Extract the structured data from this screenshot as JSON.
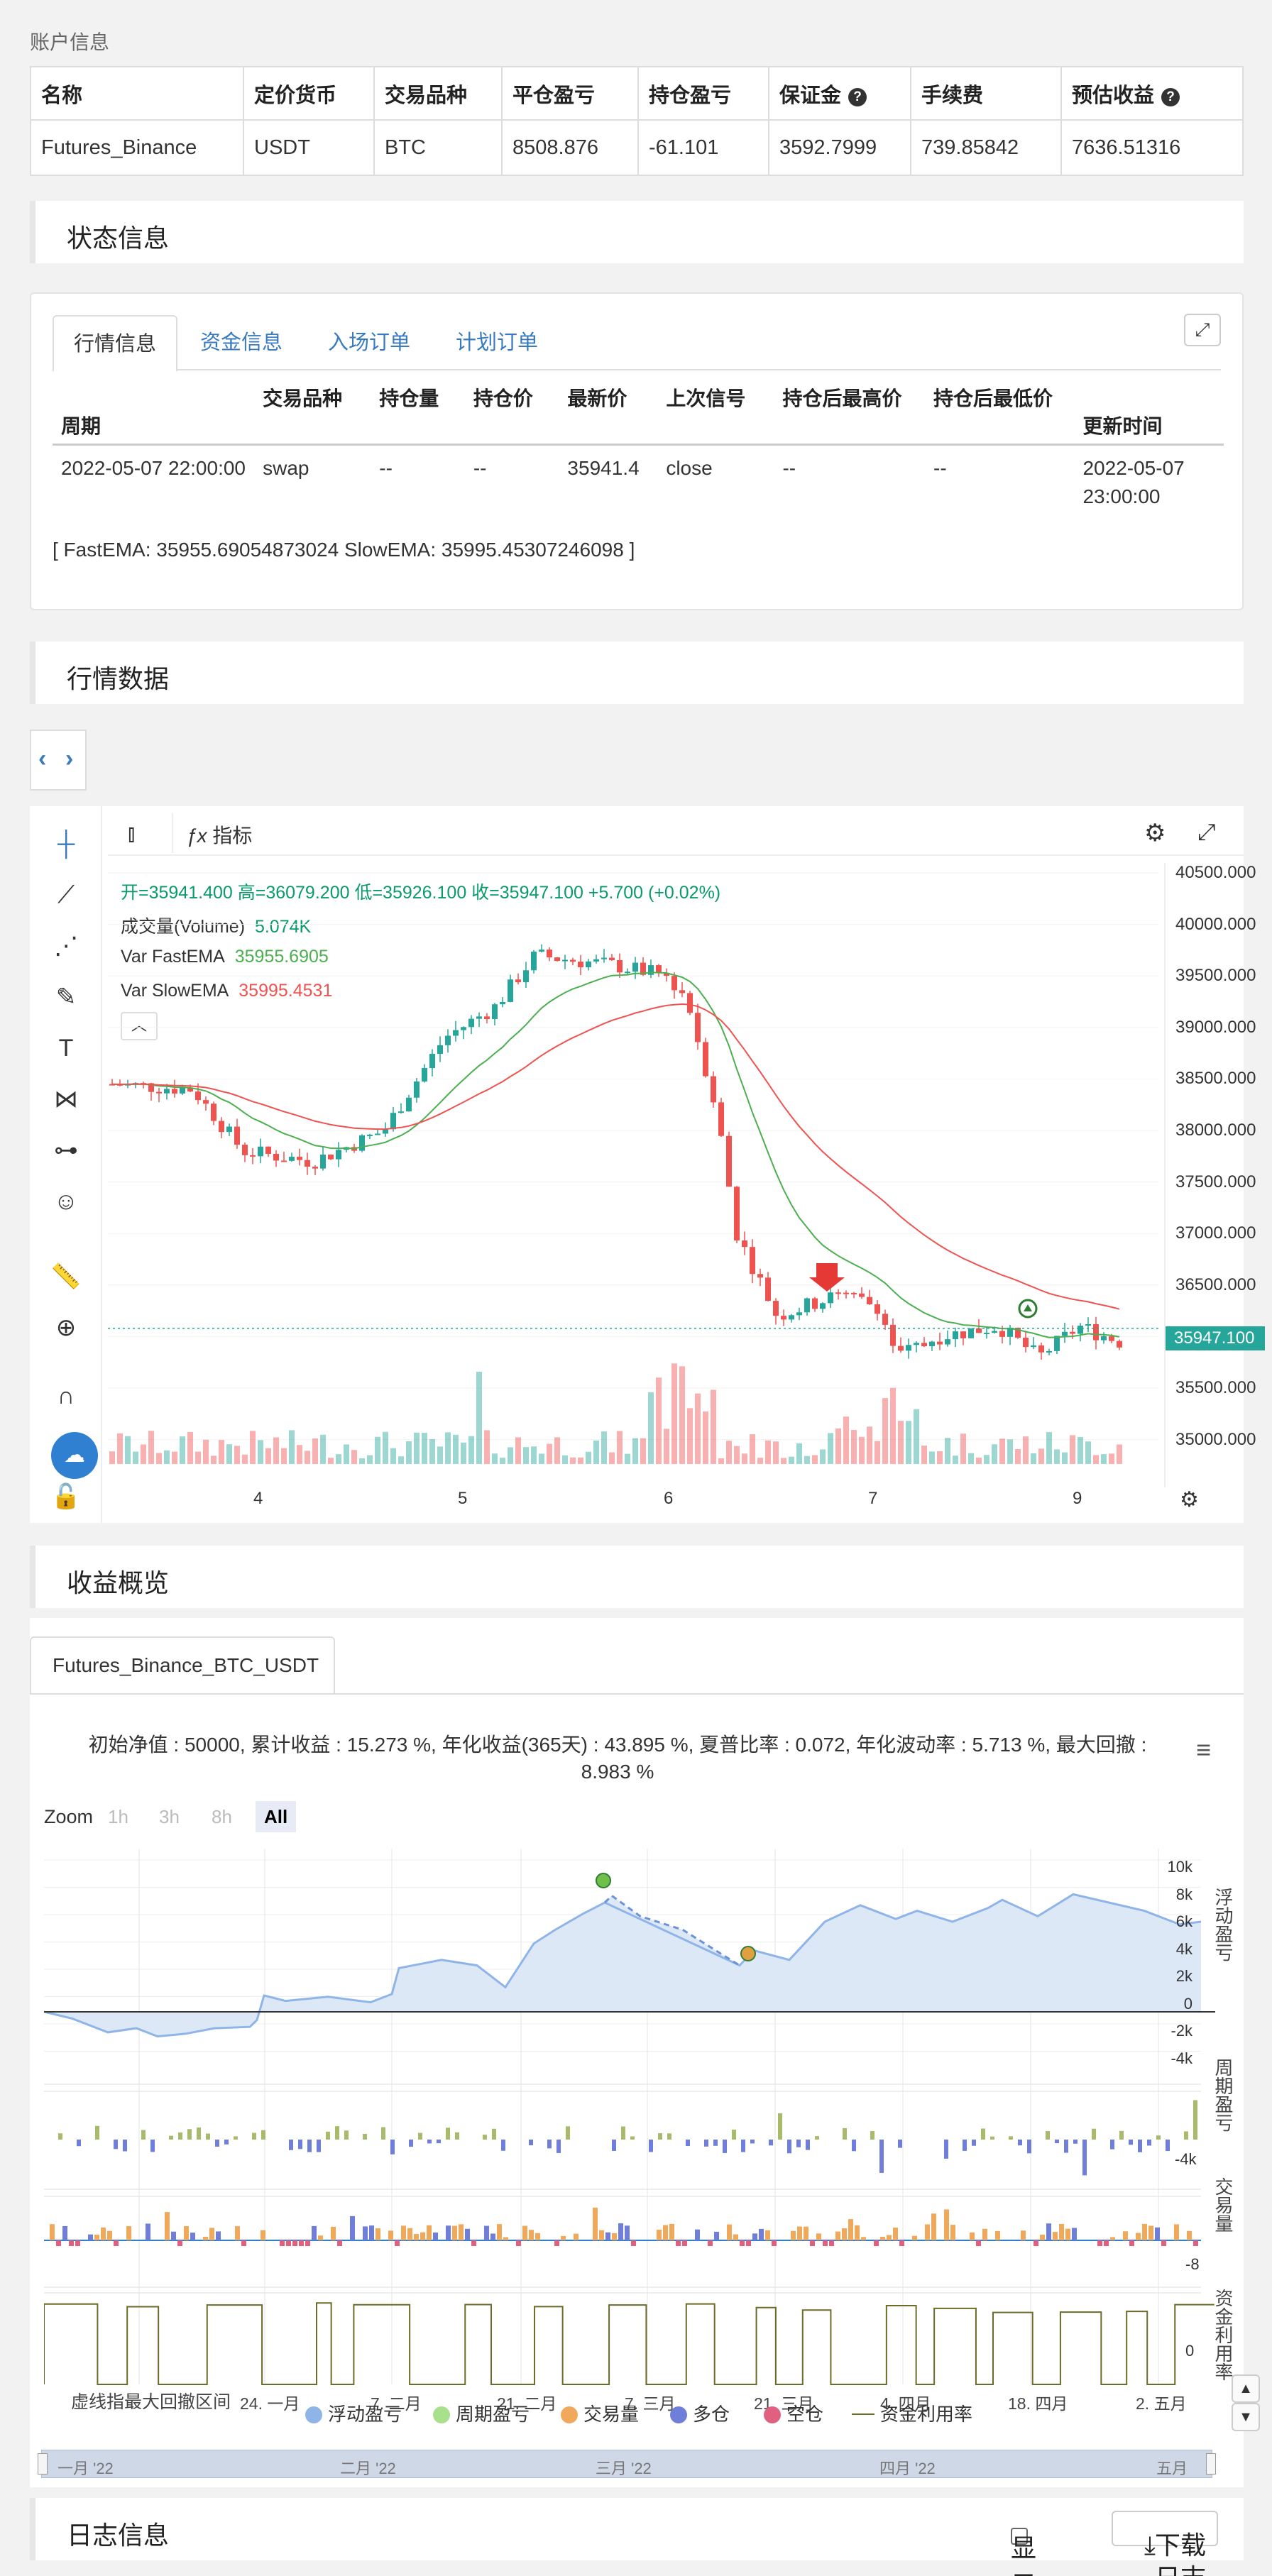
{
  "account": {
    "title": "账户信息",
    "headers": [
      "名称",
      "定价货币",
      "交易品种",
      "平仓盈亏",
      "持仓盈亏",
      "保证金",
      "手续费",
      "预估收益"
    ],
    "row": [
      "Futures_Binance",
      "USDT",
      "BTC",
      "8508.876",
      "-61.101",
      "3592.7999",
      "739.85842",
      "7636.51316"
    ],
    "help_icon": "?"
  },
  "status": {
    "title": "状态信息",
    "tabs": [
      "行情信息",
      "资金信息",
      "入场订单",
      "计划订单"
    ],
    "expand_icon": "⤢",
    "headers": [
      "周期",
      "交易品种",
      "持仓量",
      "持仓价",
      "最新价",
      "上次信号",
      "持仓后最高价",
      "持仓后最低价",
      "更新时间"
    ],
    "row": [
      "2022-05-07 22:00:00",
      "swap",
      "--",
      "--",
      "35941.4",
      "close",
      "--",
      "--",
      "2022-05-07 23:00:00"
    ],
    "ema_text": "[ FastEMA: 35955.69054873024 SlowEMA: 35995.45307246098 ]"
  },
  "market": {
    "title": "行情数据",
    "indicator_btn": "指标",
    "ohlc": "开=35941.400  高=36079.200  低=35926.100  收=35947.100  +5.700 (+0.02%)",
    "volume_label": "成交量(Volume)",
    "volume_value": "5.074K",
    "fast_label": "Var FastEMA",
    "fast_value": "35955.6905",
    "slow_label": "Var SlowEMA",
    "slow_value": "35995.4531",
    "price_ticks": [
      "40500.000",
      "40000.000",
      "39500.000",
      "39000.000",
      "38500.000",
      "38000.000",
      "37500.000",
      "37000.000",
      "36500.000",
      "36000.000",
      "35500.000",
      "35000.000"
    ],
    "last_price": "35947.100",
    "x_ticks": [
      "4",
      "5",
      "6",
      "7",
      "9"
    ],
    "colors": {
      "up": "#26a69a",
      "down": "#ef5350",
      "fast": "#4caf50",
      "slow": "#ef5350"
    }
  },
  "profit": {
    "title": "收益概览",
    "tab": "Futures_Binance_BTC_USDT",
    "stats_line1": "初始净值 : 50000, 累计收益 : 15.273 %, 年化收益(365天) : 43.895 %, 夏普比率 : 0.072, 年化波动率 : 5.713 %, 最大回撤 :",
    "stats_line2": "8.983 %",
    "menu_icon": "≡",
    "zoom_label": "Zoom",
    "zoom_buttons": [
      "1h",
      "3h",
      "8h",
      "All"
    ],
    "right_labels": [
      "浮动盈亏",
      "周期盈亏",
      "交易量",
      "资金利用率"
    ],
    "y_ticks_main": [
      "10k",
      "8k",
      "6k",
      "4k",
      "2k",
      "0",
      "-2k",
      "-4k"
    ],
    "y_tick_sub1": "-4k",
    "y_tick_sub2": "-8",
    "y_tick_sub3": "0",
    "x_labels": [
      "24. 一月",
      "7. 二月",
      "21. 二月",
      "7. 三月",
      "21. 三月",
      "4. 四月",
      "18. 四月",
      "2. 五月"
    ],
    "overlay_label": "虚线指最大回撤区间",
    "legend": [
      "浮动盈亏",
      "周期盈亏",
      "交易量",
      "多仓",
      "空仓",
      "资金利用率"
    ],
    "legend_colors": [
      "#8fb4e8",
      "#a8e08c",
      "#f0a85a",
      "#6f7ed8",
      "#e06080",
      "#6b6b2a"
    ],
    "navigator": [
      "一月 '22",
      "二月 '22",
      "三月 '22",
      "四月 '22",
      "五月"
    ]
  },
  "log": {
    "title": "日志信息",
    "show_ms": "显示毫秒",
    "download": "下载日志"
  }
}
